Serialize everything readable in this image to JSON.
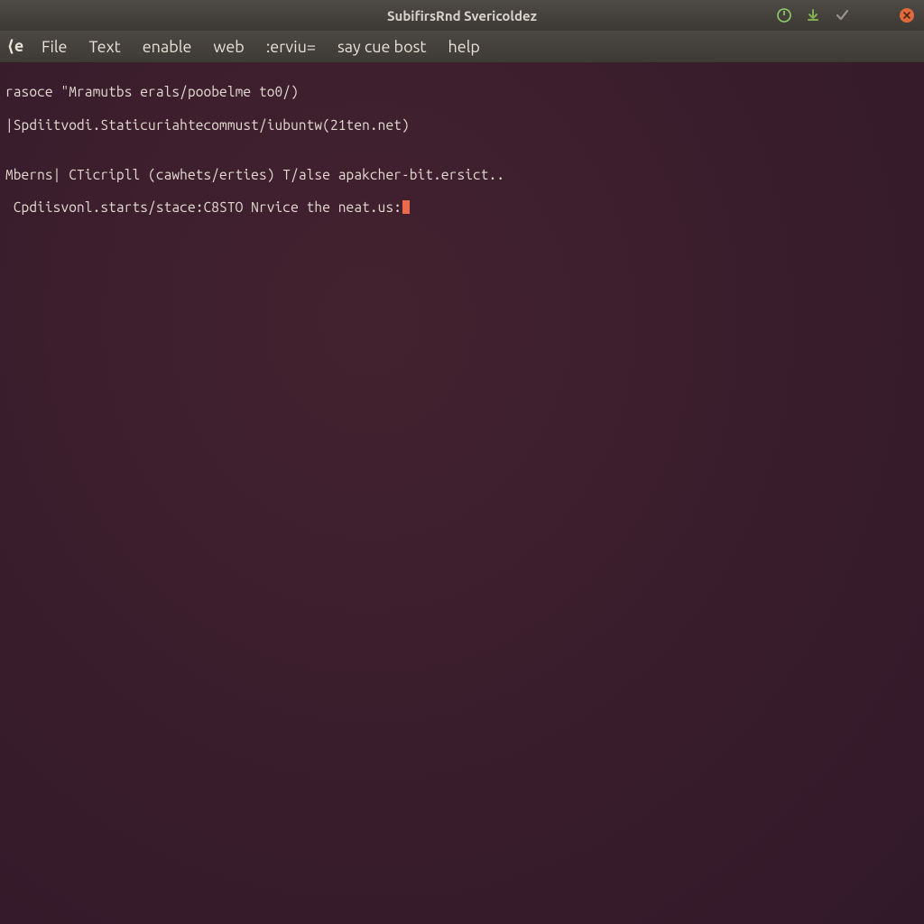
{
  "window": {
    "title": "SubifirsRnd Svericoldez"
  },
  "menubar": {
    "close_glyph": "⟨e",
    "items": [
      "File",
      "Text",
      "enable",
      "web",
      ":erviu=",
      "say cue bost",
      "help"
    ]
  },
  "tray_icons": {
    "power": "power-icon",
    "download": "download-icon",
    "check": "check-icon",
    "close": "close-icon"
  },
  "terminal": {
    "lines": [
      "rasoce \"Mramutbs erals/poobelme to0/)",
      "|Spdiitvodi.Staticuriahtecommust/iubuntw(21ten.net)",
      "",
      "Mberns| CTicripll (cawhets/erties) T/alse apakcher-bit.ersict..",
      " Cpdiisvonl.starts/stace:C8STO Nrvice the neat.us:"
    ]
  }
}
